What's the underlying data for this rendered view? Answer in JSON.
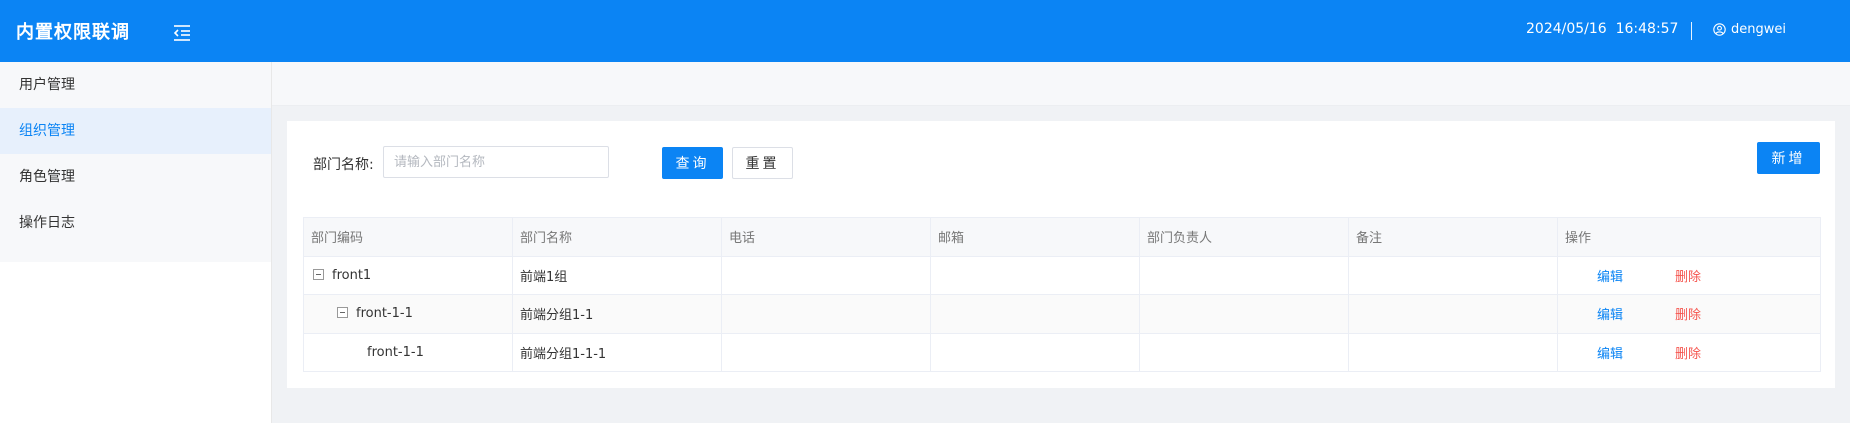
{
  "header": {
    "title": "内置权限联调",
    "datetime": "2024/05/16  16:48:57",
    "username": "dengwei"
  },
  "sidebar": {
    "items": [
      {
        "label": "用户管理"
      },
      {
        "label": "组织管理",
        "active": true
      },
      {
        "label": "角色管理"
      },
      {
        "label": "操作日志"
      }
    ]
  },
  "filter": {
    "label": "部门名称:",
    "placeholder": "请输入部门名称",
    "value": "",
    "query_label": "查询",
    "reset_label": "重置",
    "add_label": "新增"
  },
  "table": {
    "columns": [
      "部门编码",
      "部门名称",
      "电话",
      "邮箱",
      "部门负责人",
      "备注",
      "操作"
    ],
    "rows": [
      {
        "code": "front1",
        "name": "前端1组",
        "phone": "",
        "email": "",
        "leader": "",
        "remark": "",
        "level": 0,
        "expanded": true
      },
      {
        "code": "front-1-1",
        "name": "前端分组1-1",
        "phone": "",
        "email": "",
        "leader": "",
        "remark": "",
        "level": 1,
        "expanded": true
      },
      {
        "code": "front-1-1",
        "name": "前端分组1-1-1",
        "phone": "",
        "email": "",
        "leader": "",
        "remark": "",
        "level": 2
      }
    ],
    "edit_label": "编辑",
    "delete_label": "删除"
  },
  "colors": {
    "primary": "#0b84f4",
    "danger": "#f5544d",
    "sidebar_active_bg": "#e7f0fc"
  }
}
